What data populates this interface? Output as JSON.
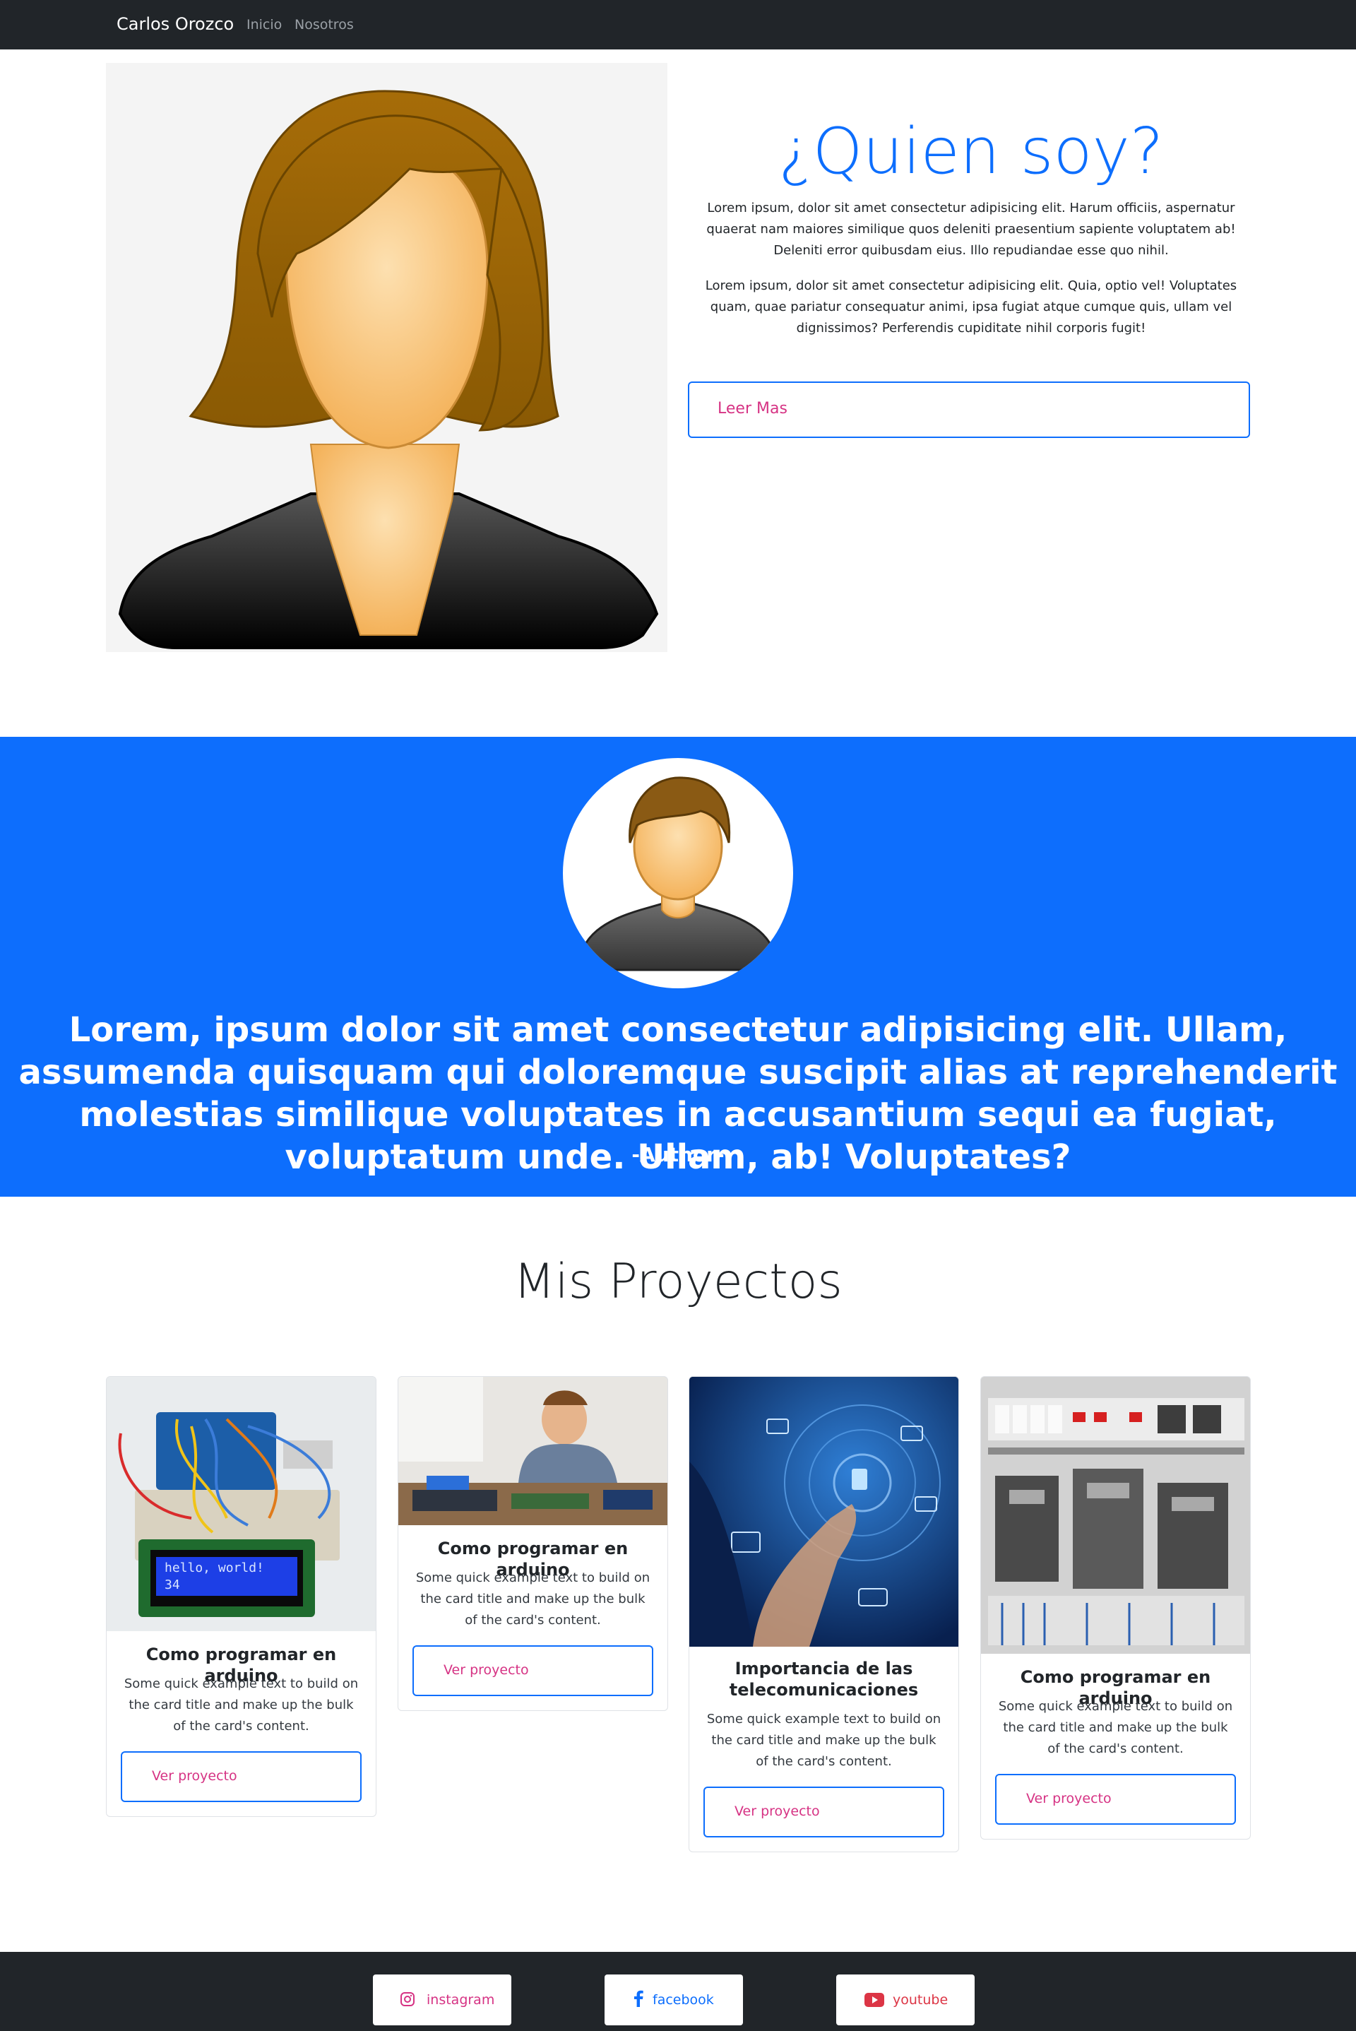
{
  "navbar": {
    "brand": "Carlos Orozco",
    "links": [
      "Inicio",
      "Nosotros"
    ]
  },
  "about": {
    "title": "¿Quien soy?",
    "paragraph_1": "Lorem ipsum, dolor sit amet consectetur adipisicing elit. Harum officiis, aspernatur quaerat nam maiores similique quos deleniti praesentium sapiente voluptatem ab! Deleniti error quibusdam eius. Illo repudiandae esse quo nihil.",
    "paragraph_2": "Lorem ipsum, dolor sit amet consectetur adipisicing elit. Quia, optio vel! Voluptates quam, quae pariatur consequatur animi, ipsa fugiat atque cumque quis, ullam vel dignissimos? Perferendis cupiditate nihil corporis fugit!",
    "button_label": "Leer Mas"
  },
  "quote": {
    "text": "Lorem, ipsum dolor sit amet consectetur adipisicing elit. Ullam, assumenda quisquam qui doloremque suscipit alias at reprehenderit molestias similique voluptates in accusantium sequi ea fugiat, voluptatum unde. Ullam, ab! Voluptates?",
    "author": "-Author-"
  },
  "projects": {
    "title": "Mis Proyectos",
    "cards": [
      {
        "title": "Como programar en arduino",
        "text": "Some quick example text to build on the card title and make up the bulk of the card's content.",
        "button": "Ver proyecto"
      },
      {
        "title": "Como programar en arduino",
        "text": "Some quick example text to build on the card title and make up the bulk of the card's content.",
        "button": "Ver proyecto"
      },
      {
        "title": "Importancia de las telecomunicaciones",
        "text": "Some quick example text to build on the card title and make up the bulk of the card's content.",
        "button": "Ver proyecto"
      },
      {
        "title": "Como programar en arduino",
        "text": "Some quick example text to build on the card title and make up the bulk of the card's content.",
        "button": "Ver proyecto"
      }
    ],
    "lcd_text": [
      "hello, world!",
      "34"
    ]
  },
  "footer": {
    "social": [
      {
        "label": "instagram",
        "icon": "instagram-icon",
        "color": "#d63384"
      },
      {
        "label": "facebook",
        "icon": "facebook-icon",
        "color": "#0d6efd"
      },
      {
        "label": "youtube",
        "icon": "youtube-icon",
        "color": "#dc3545"
      }
    ]
  },
  "colors": {
    "primary": "#0d6efd",
    "dark": "#212529",
    "link_pink": "#d63384"
  }
}
